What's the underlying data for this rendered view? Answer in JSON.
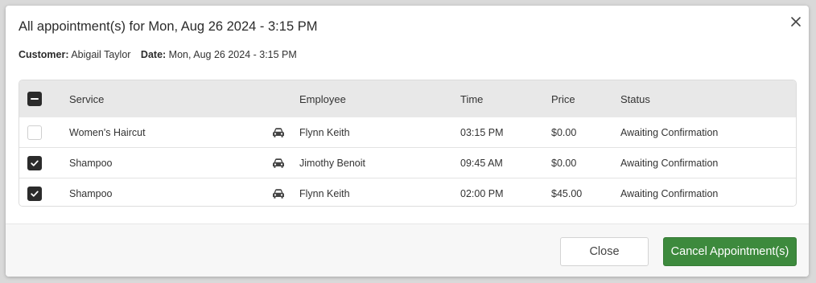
{
  "dialog": {
    "title": "All appointment(s) for Mon, Aug 26 2024 - 3:15 PM",
    "customer_label": "Customer:",
    "customer_value": "Abigail Taylor",
    "date_label": "Date:",
    "date_value": "Mon, Aug 26 2024 - 3:15 PM"
  },
  "table": {
    "select_all_state": "indeterminate",
    "headers": {
      "service": "Service",
      "employee": "Employee",
      "time": "Time",
      "price": "Price",
      "status": "Status"
    },
    "rows": [
      {
        "checked": false,
        "service": "Women's Haircut",
        "icon": "car-icon",
        "employee": "Flynn Keith",
        "time": "03:15 PM",
        "price": "$0.00",
        "status": "Awaiting Confirmation"
      },
      {
        "checked": true,
        "service": "Shampoo",
        "icon": "car-icon",
        "employee": "Jimothy Benoit",
        "time": "09:45 AM",
        "price": "$0.00",
        "status": "Awaiting Confirmation"
      },
      {
        "checked": true,
        "service": "Shampoo",
        "icon": "car-icon",
        "employee": "Flynn Keith",
        "time": "02:00 PM",
        "price": "$45.00",
        "status": "Awaiting Confirmation"
      }
    ]
  },
  "footer": {
    "close_label": "Close",
    "cancel_label": "Cancel Appointment(s)"
  },
  "colors": {
    "primary_button": "#3d8a3d",
    "checkbox_checked": "#2b2b2b",
    "header_bg": "#e8e8e8"
  }
}
